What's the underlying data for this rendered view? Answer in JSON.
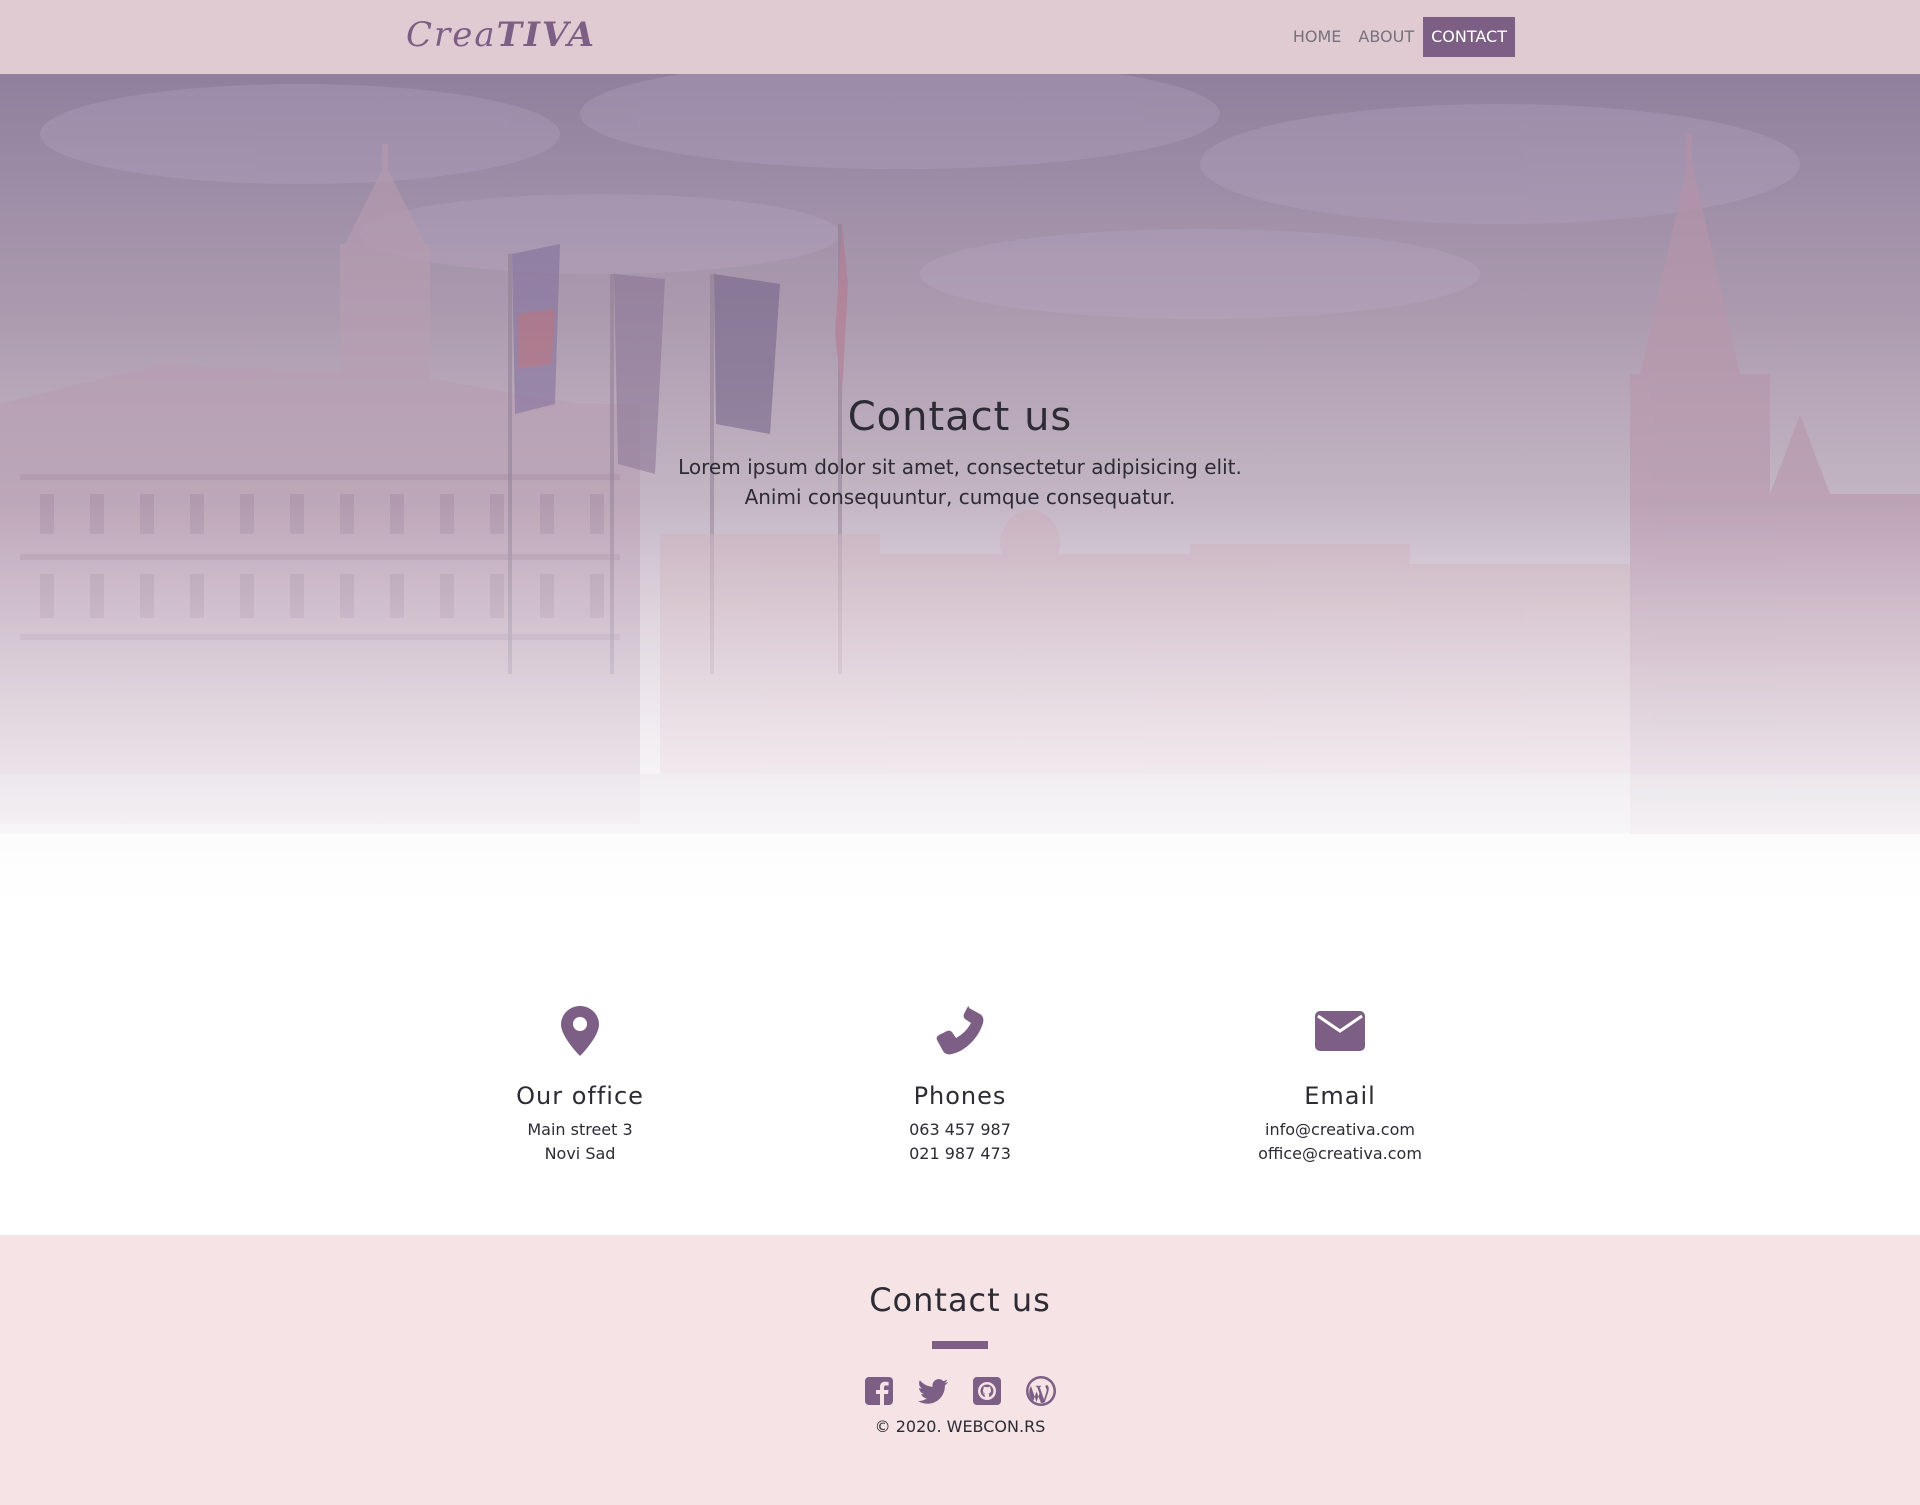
{
  "brand": {
    "part1": "Crea",
    "part2": "TIVA"
  },
  "nav": {
    "items": [
      {
        "label": "HOME",
        "active": false
      },
      {
        "label": "ABOUT",
        "active": false
      },
      {
        "label": "CONTACT",
        "active": true
      }
    ]
  },
  "hero": {
    "title": "Contact us",
    "line1": "Lorem ipsum dolor sit amet, consectetur adipisicing elit.",
    "line2": "Animi consequuntur, cumque consequatur."
  },
  "info": [
    {
      "icon": "map-marker-icon",
      "title": "Our office",
      "line1": "Main street 3",
      "line2": "Novi Sad"
    },
    {
      "icon": "phone-icon",
      "title": "Phones",
      "line1": "063 457 987",
      "line2": "021 987 473"
    },
    {
      "icon": "envelope-icon",
      "title": "Email",
      "line1": "info@creativa.com",
      "line2": "office@creativa.com"
    }
  ],
  "footer": {
    "title": "Contact us",
    "socials": [
      "facebook-icon",
      "twitter-icon",
      "github-icon",
      "wordpress-icon"
    ],
    "copyright": "© 2020. WEBCON.RS"
  },
  "colors": {
    "accent": "#7d5f86",
    "navbar": "#e1cbd3",
    "footer": "#f5e3e5"
  }
}
